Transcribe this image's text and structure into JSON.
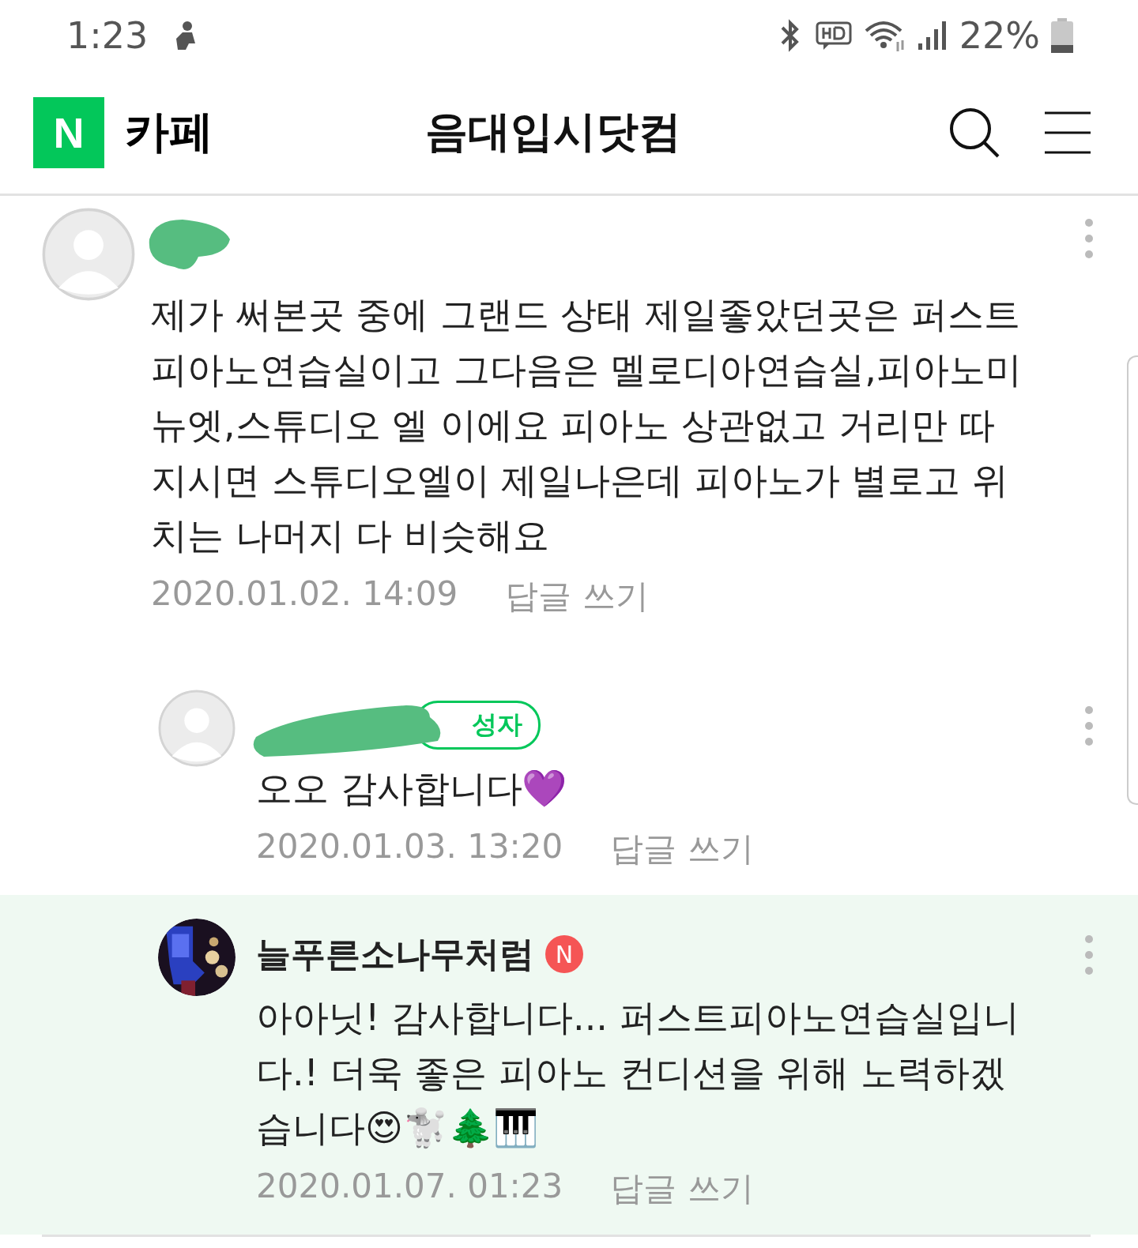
{
  "status_bar": {
    "time": "1:23",
    "battery": "22%"
  },
  "header": {
    "logo": "N",
    "service": "카페",
    "title": "음대입시닷컴"
  },
  "comments": [
    {
      "kind": "comment",
      "author_redacted": true,
      "text": "제가 써본곳 중에 그랜드 상태 제일좋았던곳은 퍼스트 피아노연습실이고 그다음은 멜로디아연습실,피아노미뉴엣,스튜디오 엘 이에요 피아노 상관없고 거리만 따지시면 스튜디오엘이 제일나은데 피아노가 별로고 위치는 나머지 다 비슷해요",
      "date": "2020.01.02. 14:09",
      "reply": "답글 쓰기",
      "highlighted": false
    },
    {
      "kind": "reply",
      "author_redacted": true,
      "badge": "성자",
      "text": "오오 감사합니다💜",
      "date": "2020.01.03. 13:20",
      "reply": "답글 쓰기",
      "highlighted": false
    },
    {
      "kind": "reply",
      "author": "늘푸른소나무처럼",
      "author_mark": "N",
      "photo": true,
      "text": "아아닛! 감사합니다... 퍼스트피아노연습실입니다.! 더욱 좋은 피아노 컨디션을 위해 노력하겠습니다😍🐩🌲🎹",
      "date": "2020.01.07. 01:23",
      "reply": "답글 쓰기",
      "highlighted": true
    }
  ]
}
